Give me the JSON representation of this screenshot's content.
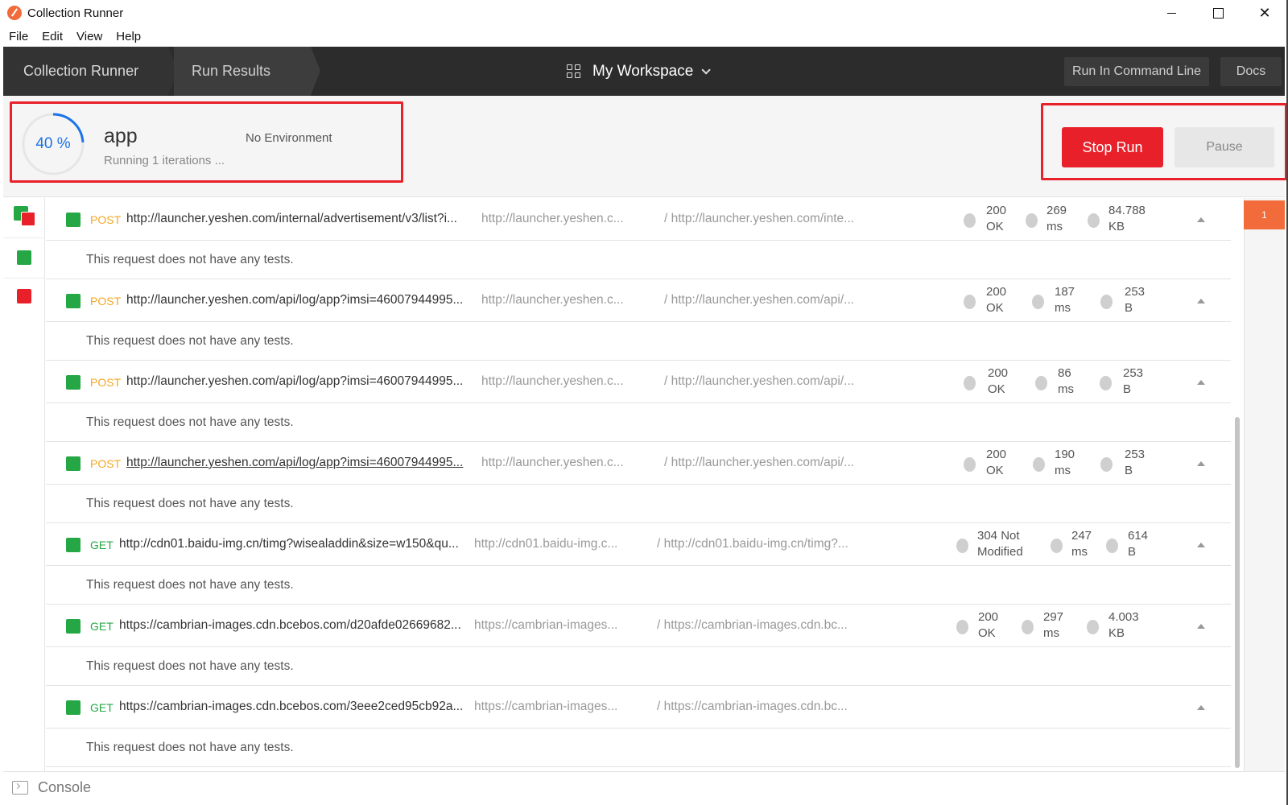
{
  "window": {
    "title": "Collection Runner",
    "minimize": "",
    "maximize": "",
    "close": "✕"
  },
  "menu": [
    "File",
    "Edit",
    "View",
    "Help"
  ],
  "header": {
    "crumbs": [
      "Collection Runner",
      "Run Results"
    ],
    "workspace": "My Workspace",
    "run_in_command_line": "Run In Command Line",
    "docs": "Docs"
  },
  "summary": {
    "progress_label": "40 %",
    "progress": 0.4,
    "collection": "app",
    "status": "Running 1 iterations ...",
    "environment": "No Environment",
    "stop_label": "Stop Run",
    "pause_label": "Pause"
  },
  "colors": {
    "accent": "#f26b3a",
    "stop": "#e8202a",
    "pass": "#26a745",
    "fail": "#e8202a",
    "post": "#f5a623",
    "progress": "#1a73e8"
  },
  "requests": [
    {
      "method": "POST",
      "url": "http://launcher.yeshen.com/internal/advertisement/v3/list?i...",
      "host": "http://launcher.yeshen.c...",
      "path": "/ http://launcher.yeshen.com/inte...",
      "status_code": "200",
      "status_text": "OK",
      "time_value": "269",
      "time_unit": "ms",
      "size_value": "84.788",
      "size_unit": "KB",
      "no_tests": "This request does not have any tests."
    },
    {
      "method": "POST",
      "url": "http://launcher.yeshen.com/api/log/app?imsi=46007944995...",
      "host": "http://launcher.yeshen.c...",
      "path": "/ http://launcher.yeshen.com/api/...",
      "status_code": "200",
      "status_text": "OK",
      "time_value": "187",
      "time_unit": "ms",
      "size_value": "253",
      "size_unit": "B",
      "no_tests": "This request does not have any tests."
    },
    {
      "method": "POST",
      "url": "http://launcher.yeshen.com/api/log/app?imsi=46007944995...",
      "host": "http://launcher.yeshen.c...",
      "path": "/ http://launcher.yeshen.com/api/...",
      "status_code": "200",
      "status_text": "OK",
      "time_value": "86",
      "time_unit": "ms",
      "size_value": "253",
      "size_unit": "B",
      "no_tests": "This request does not have any tests."
    },
    {
      "method": "POST",
      "url": "http://launcher.yeshen.com/api/log/app?imsi=46007944995...",
      "host": "http://launcher.yeshen.c...",
      "path": "/ http://launcher.yeshen.com/api/...",
      "status_code": "200",
      "status_text": "OK",
      "time_value": "190",
      "time_unit": "ms",
      "size_value": "253",
      "size_unit": "B",
      "no_tests": "This request does not have any tests."
    },
    {
      "method": "GET",
      "url": "http://cdn01.baidu-img.cn/timg?wisealaddin&size=w150&qu...",
      "host": "http://cdn01.baidu-img.c...",
      "path": "/ http://cdn01.baidu-img.cn/timg?...",
      "status_code": "304 Not",
      "status_text": "Modified",
      "time_value": "247",
      "time_unit": "ms",
      "size_value": "614",
      "size_unit": "B",
      "no_tests": "This request does not have any tests."
    },
    {
      "method": "GET",
      "url": "https://cambrian-images.cdn.bcebos.com/d20afde02669682...",
      "host": "https://cambrian-images...",
      "path": "/ https://cambrian-images.cdn.bc...",
      "status_code": "200",
      "status_text": "OK",
      "time_value": "297",
      "time_unit": "ms",
      "size_value": "4.003",
      "size_unit": "KB",
      "no_tests": "This request does not have any tests."
    },
    {
      "method": "GET",
      "url": "https://cambrian-images.cdn.bcebos.com/3eee2ced95cb92a...",
      "host": "https://cambrian-images...",
      "path": "/ https://cambrian-images.cdn.bc...",
      "status_code": "",
      "status_text": "",
      "time_value": "",
      "time_unit": "",
      "size_value": "",
      "size_unit": "",
      "no_tests": "This request does not have any tests."
    }
  ],
  "iteration_badge": "1",
  "footer": {
    "console": "Console"
  }
}
